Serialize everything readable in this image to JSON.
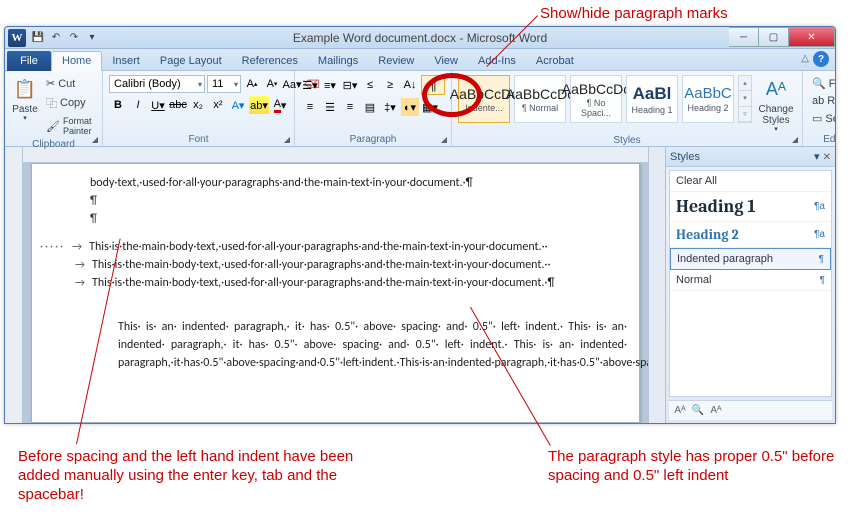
{
  "annotations": {
    "top": "Show/hide paragraph marks",
    "bottom_left": "Before spacing and the left hand indent have been added manually using the enter key, tab and the spacebar!",
    "bottom_right": "The paragraph style has proper 0.5\" before spacing and 0.5\" left indent"
  },
  "titlebar": {
    "app_letter": "W",
    "title": "Example Word document.docx - Microsoft Word"
  },
  "tabs": {
    "file": "File",
    "list": [
      "Home",
      "Insert",
      "Page Layout",
      "References",
      "Mailings",
      "Review",
      "View",
      "Add-Ins",
      "Acrobat"
    ]
  },
  "ribbon": {
    "clipboard": {
      "label": "Clipboard",
      "paste": "Paste",
      "cut": "Cut",
      "copy": "Copy",
      "format_painter": "Format Painter"
    },
    "font": {
      "label": "Font",
      "name": "Calibri (Body)",
      "size": "11"
    },
    "paragraph": {
      "label": "Paragraph"
    },
    "styles": {
      "label": "Styles",
      "tiles": [
        {
          "sample": "AaBbCcDc",
          "name": "Indente..."
        },
        {
          "sample": "AaBbCcDc",
          "name": "¶ Normal"
        },
        {
          "sample": "AaBbCcDc",
          "name": "¶ No Spaci..."
        },
        {
          "sample": "AaBl",
          "name": "Heading 1"
        },
        {
          "sample": "AaBbC",
          "name": "Heading 2"
        }
      ],
      "change": "Change Styles"
    },
    "editing": {
      "label": "Editing",
      "find": "Find",
      "replace": "Replace",
      "select": "Select"
    }
  },
  "document": {
    "line1": "body·text,·used·for·all·your·paragraphs·and·the·main·text·in·your·document.·",
    "repeat": "This·is·the·main·body·text,·used·for·all·your·paragraphs·and·the·main·text·in·your·document.·",
    "indented": "This· is· an· indented· paragraph,· it· has· 0.5\"· above· spacing· and· 0.5\"· left· indent.· This· is· an· indented· paragraph,· it· has· 0.5\"· above· spacing· and· 0.5\"· left· indent.· This· is· an· indented· paragraph,·it·has·0.5\"·above·spacing·and·0.5\"·left·indent.·This·is·an·indented·paragraph,·it·has·0.5\"·above·spacing·and·0.5\"·left·indent.·This·is·an·indented·paragraph,·it·has·0.5\"·above·spacing·and·0.5\"·left·indent.·"
  },
  "styles_pane": {
    "title": "Styles",
    "clear": "Clear All",
    "items": [
      "Heading 1",
      "Heading 2",
      "Indented paragraph",
      "Normal"
    ]
  }
}
